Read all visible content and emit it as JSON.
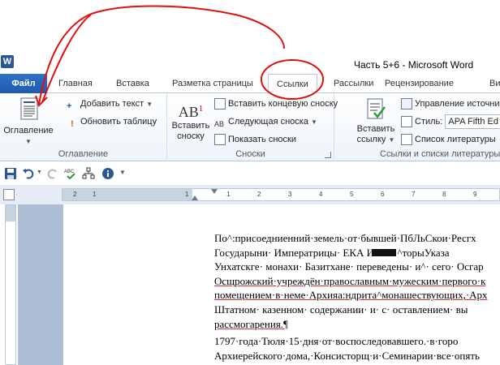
{
  "window": {
    "app_letter": "W",
    "title": "Часть 5+6  -  Microsoft Word"
  },
  "tabs": {
    "file": "Файл",
    "items": [
      "Главная",
      "Вставка",
      "Разметка страницы",
      "Ссылки",
      "Рассылки",
      "Рецензирование",
      "Ви"
    ]
  },
  "ribbon": {
    "toc_group": {
      "label": "Оглавление",
      "toc_button": "Оглавление",
      "add_text": "Добавить текст",
      "update_table": "Обновить таблицу"
    },
    "footnotes_group": {
      "label": "Сноски",
      "insert_footnote": "Вставить сноску",
      "insert_footnote_line1": "Вставить",
      "insert_footnote_line2": "сноску",
      "ab_glyph": "AB",
      "ab_sup": "1",
      "insert_endnote": "Вставить концевую сноску",
      "next_footnote": "Следующая сноска",
      "show_notes": "Показать сноски"
    },
    "citations_group": {
      "label": "Ссылки и списки литературы",
      "insert_citation_line1": "Вставить",
      "insert_citation_line2": "ссылку",
      "manage_sources": "Управление источни",
      "style_label": "Стиль:",
      "style_value": "APA Fifth Ed",
      "bibliography": "Список литературы"
    }
  },
  "ruler": {
    "numbers": [
      "1",
      "2",
      "1",
      "1",
      "2",
      "3",
      "4",
      "5",
      "6",
      "7",
      "8",
      "9",
      "10",
      "11",
      "12",
      "13",
      "14"
    ]
  },
  "document": {
    "paragraph1_lines": [
      "По^:присоедниенний·земель·от·бывшей·ПбЛьСкои·Ресгх",
      "Государыни· Императрицы· ЕКА     ИНЫ· ^торыУказа",
      "Унхатскге· монахи· Базитхане· переведены· и^· сего· Осгар",
      "Осщрожский·учреждён·православным·мужеским·первого·к",
      "помещением·в·неме·Архияа:ндрита^монашествующих,·Арх",
      "Штатном· казенном· содержании· и· с· оставлением· вы",
      "рассмогарения.¶"
    ],
    "paragraph2_lines": [
      "1797·года·Тюля·15·дня·от·воспоследовавшего.·в·горо",
      "Архиерейского·дома,·Консисторщ·и·Семинарии·все·опять"
    ]
  },
  "colors": {
    "accent": "#1d5bae",
    "annotation": "#e01010",
    "workspace": "#aebfd5"
  }
}
